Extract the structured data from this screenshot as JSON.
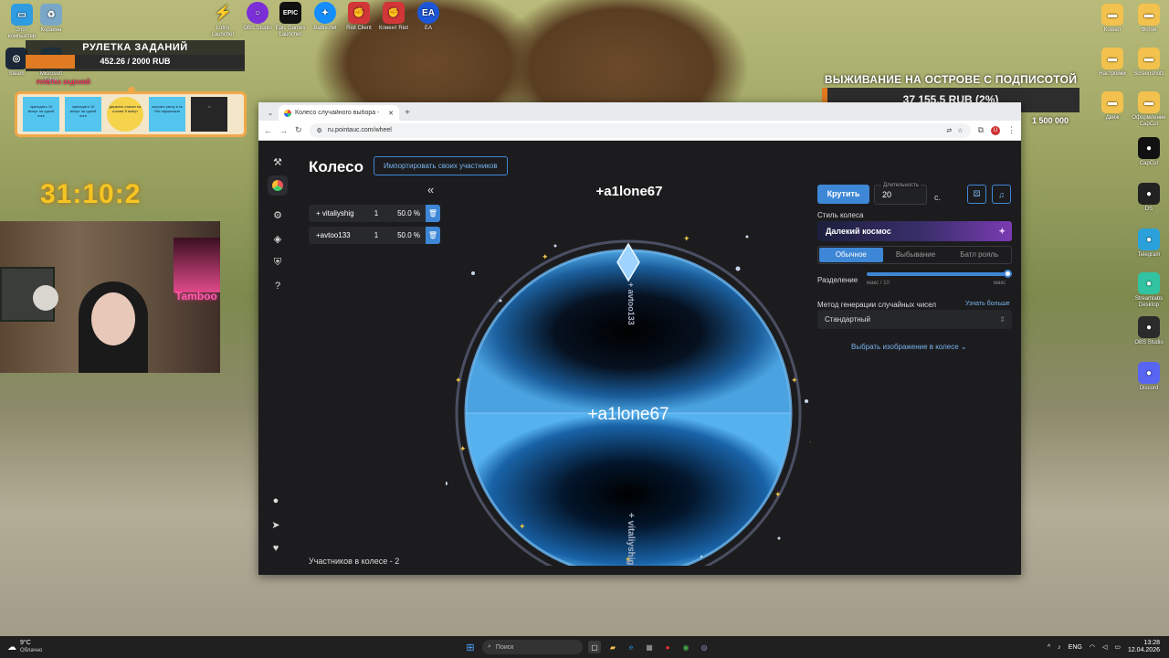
{
  "desktop_left_icons": [
    {
      "label": "Этот компьютер",
      "icon": "computer-icon",
      "color": "#2f9be0"
    },
    {
      "label": "Корзина",
      "icon": "recycle-bin-icon",
      "color": "#7aa7c7"
    },
    {
      "label": "Steam",
      "icon": "steam-icon",
      "color": "#1b2838"
    },
    {
      "label": "Microsoft Edge",
      "icon": "edge-icon",
      "color": "#1a8fce"
    }
  ],
  "desktop_top_icons": [
    {
      "label": "Lutris Launcher",
      "icon": "lightning-icon",
      "color": "#f4c20d"
    },
    {
      "label": "OBS Studio",
      "icon": "ring-icon",
      "color": "#7b2fd6"
    },
    {
      "label": "Epic Games Launcher",
      "icon": "epic-icon",
      "color": "#111111",
      "glyph": "EPIC"
    },
    {
      "label": "Battle.net",
      "icon": "battlenet-icon",
      "color": "#148eff"
    },
    {
      "label": "Riot Client",
      "icon": "riot-icon",
      "color": "#d13639"
    },
    {
      "label": "Клиент Riot",
      "icon": "riot-icon",
      "color": "#d13639"
    },
    {
      "label": "EA",
      "icon": "ea-icon",
      "color": "#1c57d9",
      "glyph": "EA"
    }
  ],
  "desktop_right_icons": [
    {
      "label": "Кошел",
      "icon": "folder-icon",
      "color": "#f2c14e"
    },
    {
      "label": "Фотки",
      "icon": "folder-icon",
      "color": "#f2c14e"
    },
    {
      "label": "Настройки",
      "icon": "folder-icon",
      "color": "#f2c14e"
    },
    {
      "label": "Screenshots",
      "icon": "folder-icon",
      "color": "#f2c14e"
    },
    {
      "label": "Движ",
      "icon": "folder-icon",
      "color": "#f2c14e"
    },
    {
      "label": "Оформление CapCut",
      "icon": "folder-icon",
      "color": "#f2c14e"
    },
    {
      "label": "CapCut",
      "icon": "capcut-icon",
      "color": "#111111"
    },
    {
      "label": "DS",
      "icon": "ds-icon",
      "color": "#222222"
    },
    {
      "label": "Telegram",
      "icon": "telegram-icon",
      "color": "#2aa1da"
    },
    {
      "label": "Streamlabs Desktop",
      "icon": "streamlabs-icon",
      "color": "#31c3a2"
    },
    {
      "label": "OBS Studio",
      "icon": "obs-icon",
      "color": "#2b2b2b"
    },
    {
      "label": "Discord",
      "icon": "discord-icon",
      "color": "#5865f2"
    }
  ],
  "roulette": {
    "title": "РУЛЕТКА ЗАДАНИЙ",
    "progress_text": "452.26 / 2000 RUB",
    "progress_fraction": 0.226,
    "sub_label": "РУЛЕТКА ЗАДАНИЙ"
  },
  "tasks": [
    {
      "text": "приседать 10 минут на одной ноге"
    },
    {
      "text": "приседать 10 минут на одной ноге"
    },
    {
      "text": "держать стакан на голове 5 минут"
    },
    {
      "text": "сыграть катку в cs без наушников"
    },
    {
      "text": ""
    }
  ],
  "timer": "31:10:2",
  "cam": {
    "sign_text": "Tamboo"
  },
  "goal": {
    "title": "ВЫЖИВАНИЕ НА ОСТРОВЕ С ПОДПИСОТОЙ",
    "amount": "37 155.5 RUB (2%)",
    "fraction": 0.02,
    "max": "1 500 000"
  },
  "browser": {
    "tab_title": "Колесо случайного выбора - ",
    "url": "ru.pointauc.com/wheel"
  },
  "app": {
    "title": "Колесо",
    "import_button": "Импортировать своих участников",
    "collapse_glyph": "«",
    "participants": [
      {
        "name": "+ vitaliyshig",
        "count": "1",
        "percent": "50.0 %"
      },
      {
        "name": "+avtoo133",
        "count": "1",
        "percent": "50.0 %"
      }
    ],
    "participants_count": "Участников в колесе - 2",
    "winner_top": "+a1lone67",
    "winner_center": "+a1lone67",
    "segment_top_label": "+ avtoo133",
    "segment_bottom_label": "+ vitaliyshig",
    "spin_button": "Крутить",
    "duration_label": "Длительность",
    "duration_value": "20",
    "duration_unit": "с.",
    "style_label": "Стиль колеса",
    "style_value": "Далекий космос",
    "modes": [
      "Обычное",
      "Выбывание",
      "Батл рояль"
    ],
    "active_mode": 0,
    "split_label": "Разделение",
    "split_min": "макс / 10",
    "split_max": "макс",
    "split_value_fraction": 1.0,
    "rng_label": "Метод генерации случайных чисел",
    "rng_link": "Узнать больше",
    "rng_value": "Стандартный",
    "image_link": "Выбрать изображение в колесе"
  },
  "taskbar": {
    "weather_temp": "9°C",
    "weather_text": "Облачно",
    "search_placeholder": "Поиск",
    "lang": "ENG",
    "time": "13:28",
    "date": "12.04.2026"
  },
  "colors": {
    "accent": "#3e87d6",
    "progress": "#e07b22",
    "timer": "#f6c523"
  }
}
